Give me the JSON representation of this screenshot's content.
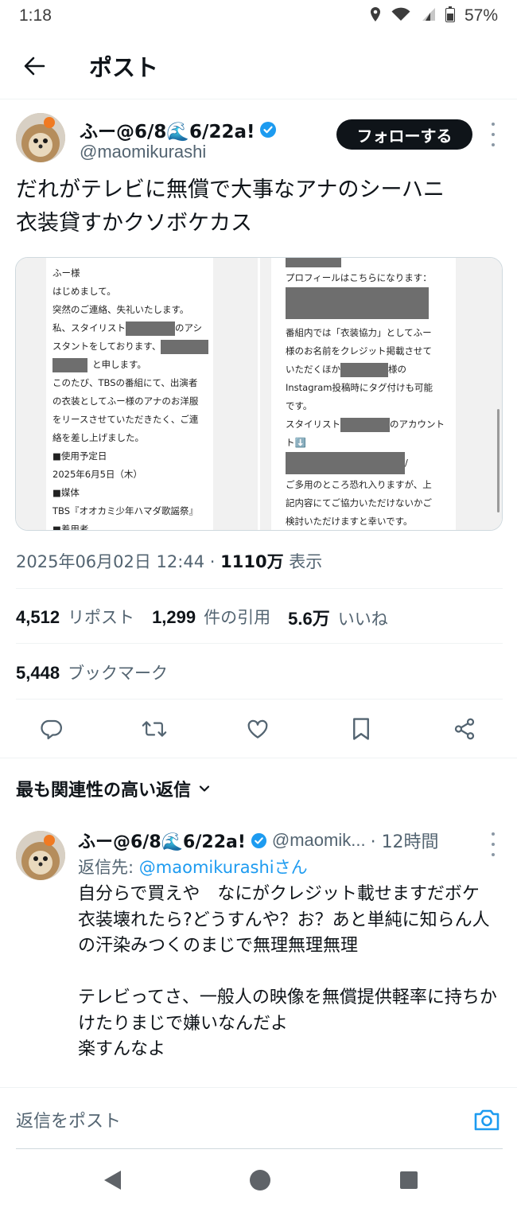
{
  "status_bar": {
    "time": "1:18",
    "battery": "57%"
  },
  "header": {
    "title": "ポスト"
  },
  "author": {
    "name": "ふー@6/8🌊6/22a!",
    "handle": "@maomikurashi",
    "follow_label": "フォローする"
  },
  "tweet": {
    "lines": [
      "だれがテレビに無償で大事なアナのシーハニ",
      "衣装貸すかクソボケカス"
    ],
    "timestamp": "2025年06月02日 12:44",
    "views_count": "1110万",
    "views_label": "表示"
  },
  "media_left": [
    "ふー様",
    "はじめまして。",
    "突然のご連絡、失礼いたします。",
    "私、スタイリスト",
    "のアシ",
    "スタントをしております、",
    "と申します。",
    "このたび、TBSの番組にて、出演者",
    "の衣装としてふー様のアナのお洋服",
    "をリースさせていただきたく、ご連",
    "絡を差し上げました。",
    "■使用予定日",
    "2025年6月5日（木）",
    "■媒体",
    "TBS『オオカミ少年ハマダ歌謡祭』",
    "■着用者"
  ],
  "media_right": [
    "プロフィールはこちらになります：",
    "番組内では「衣装協力」としてふー",
    "様のお名前をクレジット掲載させて",
    "いただくほか",
    "様の",
    "Instagram投稿時にタグ付けも可能",
    "です。",
    "スタイリスト",
    "のアカウント",
    "ト⬇️",
    "/",
    "ご多用のところ恐れ入りますが、上",
    "記内容にてご協力いただけないかご",
    "検討いただけますと幸いです。"
  ],
  "stats": {
    "reposts_count": "4,512",
    "reposts_label": "リポスト",
    "quotes_count": "1,299",
    "quotes_label": "件の引用",
    "likes_count": "5.6万",
    "likes_label": "いいね",
    "bookmarks_count": "5,448",
    "bookmarks_label": "ブックマーク"
  },
  "replies_sort": {
    "label": "最も関連性の高い返信"
  },
  "reply": {
    "name": "ふー@6/8🌊6/22a!",
    "handle": "@maomik...",
    "time": "· 12時間",
    "replying_prefix": "返信先:",
    "replying_to": "@maomikurashiさん",
    "body": "自分らで買えや　なにがクレジット載せますだボケ　衣装壊れたら?どうすんや？お？あと単純に知らん人の汗染みつくのまじで無理無理無理\n\nテレビってさ、一般人の映像を無償提供軽率に持ちかけたりまじで嫌いなんだよ\n楽すんなよ"
  },
  "reply_bar": {
    "placeholder": "返信をポスト"
  },
  "colors": {
    "accent": "#1d9bf0",
    "text": "#0f1419",
    "muted": "#536471",
    "border": "#eff3f4"
  },
  "icons": [
    "location-icon",
    "wifi-icon",
    "signal-icon",
    "battery-icon",
    "back-arrow-icon",
    "verified-badge-icon",
    "reply-icon",
    "repost-icon",
    "like-icon",
    "bookmark-icon",
    "share-icon",
    "chevron-down-icon",
    "camera-icon",
    "nav-back-icon",
    "nav-home-icon",
    "nav-recents-icon"
  ]
}
